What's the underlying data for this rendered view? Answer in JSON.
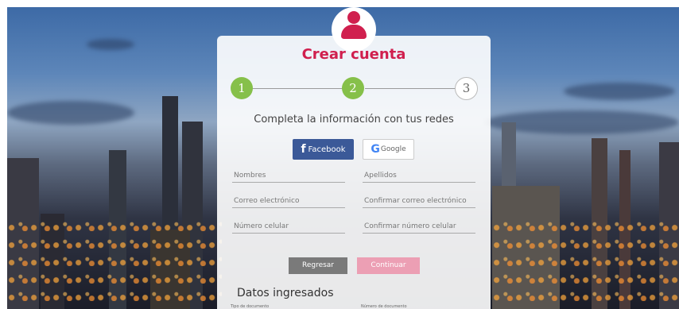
{
  "card": {
    "title": "Crear cuenta"
  },
  "steps": [
    {
      "number": "1",
      "state": "done"
    },
    {
      "number": "2",
      "state": "done"
    },
    {
      "number": "3",
      "state": "todo"
    }
  ],
  "subtitle": "Completa la información con tus redes",
  "social": {
    "facebook_icon": "f",
    "facebook_label": "Facebook",
    "google_icon": "G",
    "google_label": "Google"
  },
  "form": {
    "nombres": "Nombres",
    "apellidos": "Apellidos",
    "correo": "Correo electrónico",
    "confirmar_correo": "Confirmar correo electrónico",
    "numero": "Número celular",
    "confirmar_numero": "Confirmar número celular"
  },
  "actions": {
    "back": "Regresar",
    "next": "Continuar"
  },
  "summary": {
    "title": "Datos ingresados",
    "tipo_documento": "Tipo de documento",
    "numero_documento": "Número de documento"
  },
  "colors": {
    "brand": "#d01f4e",
    "step_done": "#86c04a",
    "facebook": "#3b5998",
    "back_btn": "#7a7a7a",
    "next_btn": "#ec9fb4"
  }
}
